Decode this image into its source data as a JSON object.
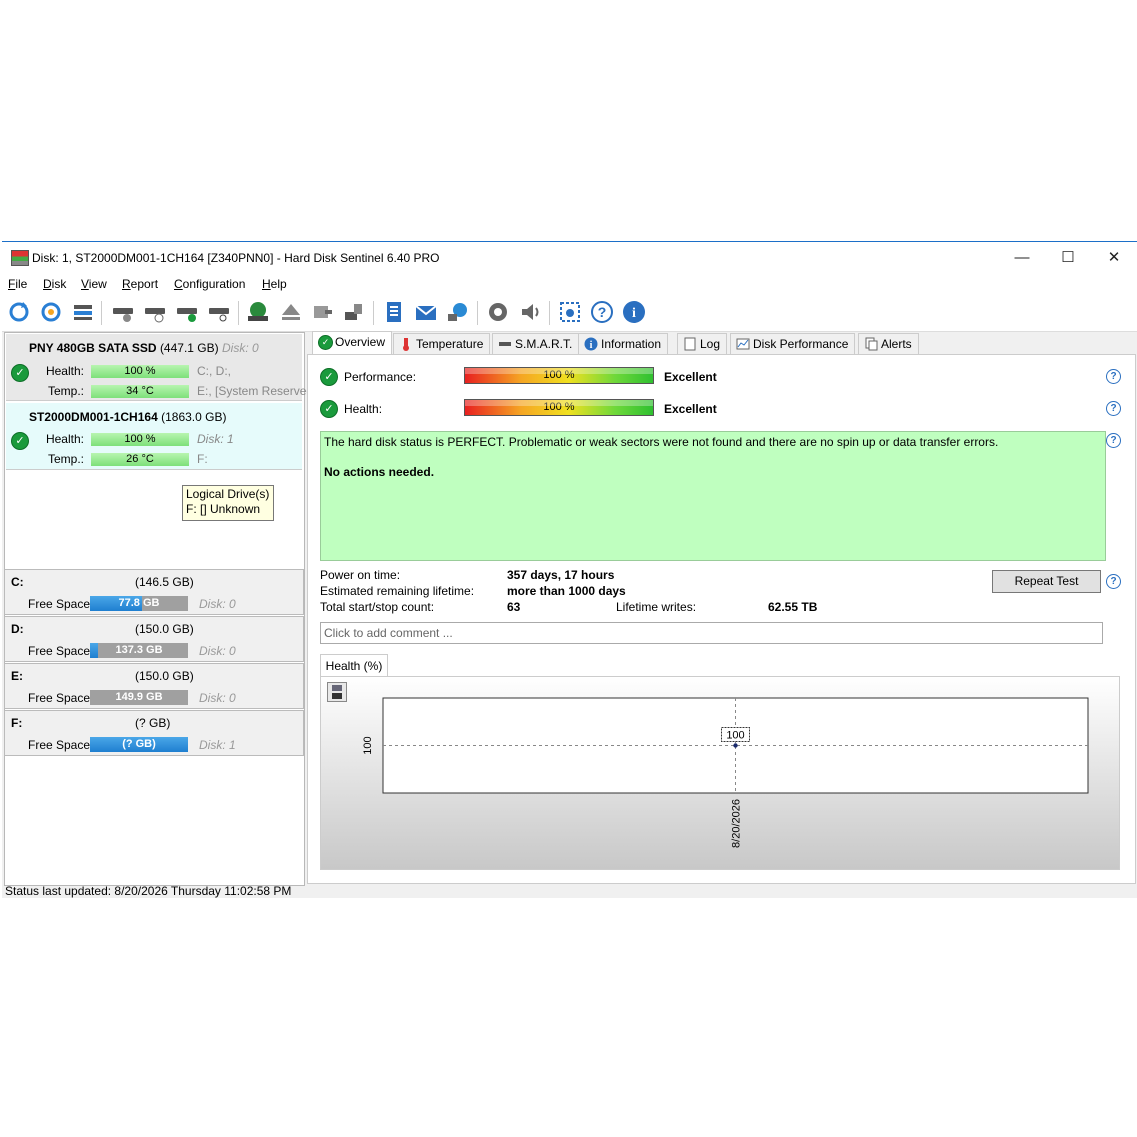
{
  "window": {
    "title": "Disk: 1, ST2000DM001-1CH164 [Z340PNN0]  -  Hard Disk Sentinel 6.40 PRO",
    "minimize": "—",
    "maximize": "☐",
    "close": "✕"
  },
  "menu": [
    "File",
    "Disk",
    "View",
    "Report",
    "Configuration",
    "Help"
  ],
  "disks": [
    {
      "name": "PNY 480GB SATA SSD",
      "size": "(447.1 GB)",
      "ref": "Disk: 0",
      "health_label": "Health:",
      "health": "100 %",
      "temp_label": "Temp.:",
      "temp": "34 °C",
      "side1": "C:, D:,",
      "side2": "E:, [System Reserved]"
    },
    {
      "name": "ST2000DM001-1CH164",
      "size": "(1863.0 GB)",
      "ref": "",
      "health_label": "Health:",
      "health": "100 %",
      "temp_label": "Temp.:",
      "temp": "26 °C",
      "side1": "Disk: 1",
      "side2": "F:"
    }
  ],
  "tooltip": {
    "line1": "Logical Drive(s)",
    "line2": "F: [] Unknown"
  },
  "volumes": [
    {
      "letter": "C:",
      "size": "(146.5 GB)",
      "free_label": "Free Space",
      "free": "77.8 GB",
      "used_fraction": 0.53,
      "disk": "Disk: 0"
    },
    {
      "letter": "D:",
      "size": "(150.0 GB)",
      "free_label": "Free Space",
      "free": "137.3 GB",
      "used_fraction": 0.08,
      "disk": "Disk: 0"
    },
    {
      "letter": "E:",
      "size": "(150.0 GB)",
      "free_label": "Free Space",
      "free": "149.9 GB",
      "used_fraction": 0.0,
      "disk": "Disk: 0"
    },
    {
      "letter": "F:",
      "size": "(? GB)",
      "free_label": "Free Space",
      "free": "(? GB)",
      "used_fraction": 1.0,
      "disk": "Disk: 1"
    }
  ],
  "tabs": [
    "Overview",
    "Temperature",
    "S.M.A.R.T.",
    "Information",
    "Log",
    "Disk Performance",
    "Alerts"
  ],
  "overview": {
    "performance_label": "Performance:",
    "performance_value": "100 %",
    "performance_rating": "Excellent",
    "health_label": "Health:",
    "health_value": "100 %",
    "health_rating": "Excellent",
    "status_text": "The hard disk status is PERFECT. Problematic or weak sectors were not found and there are no spin up or data transfer errors.",
    "status_action": "No actions needed.",
    "power_on_label": "Power on time:",
    "power_on_value": "357 days, 17 hours",
    "lifetime_label": "Estimated remaining lifetime:",
    "lifetime_value": "more than 1000 days",
    "startstop_label": "Total start/stop count:",
    "startstop_value": "63",
    "writes_label": "Lifetime writes:",
    "writes_value": "62.55 TB",
    "repeat_button": "Repeat Test",
    "comment_placeholder": "Click to add comment ...",
    "health_tab": "Health (%)"
  },
  "chart_data": {
    "type": "line",
    "x": [
      "8/20/2026"
    ],
    "series": [
      {
        "values": [
          100
        ]
      }
    ],
    "data_labels": [
      "100"
    ],
    "y_tick_labels": [
      "100"
    ],
    "grid": true
  },
  "statusbar": "Status last updated: 8/20/2026 Thursday 11:02:58 PM",
  "colors": {
    "accent": "#1a9a3c",
    "status_bg": "#bfffbf",
    "free_bar": "#1f7fd0"
  }
}
